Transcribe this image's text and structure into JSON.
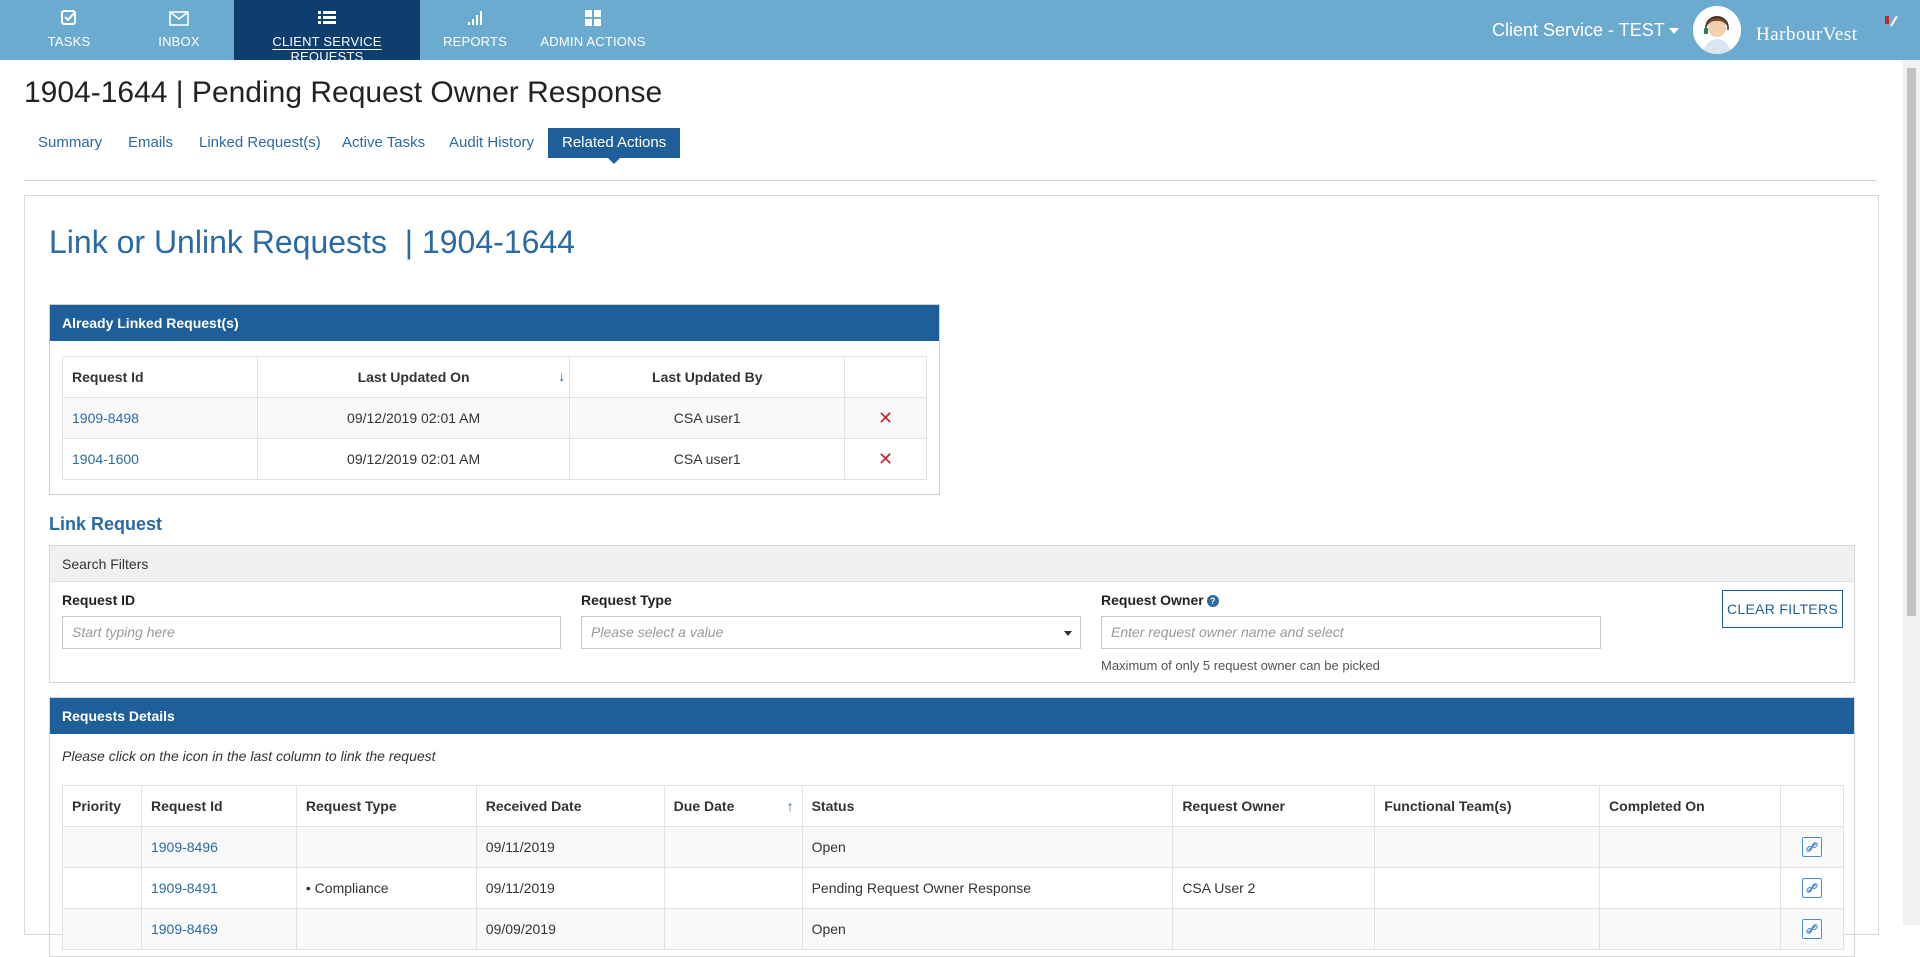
{
  "nav": {
    "items": [
      {
        "label": "TASKS",
        "icon": "checkbox-icon"
      },
      {
        "label": "INBOX",
        "icon": "envelope-icon"
      },
      {
        "label": "CLIENT SERVICE REQUESTS",
        "icon": "list-icon",
        "active": true
      },
      {
        "label": "REPORTS",
        "icon": "signal-bars-icon"
      },
      {
        "label": "ADMIN ACTIONS",
        "icon": "grid-icon"
      }
    ],
    "user_menu": "Client Service - TEST",
    "brand": "HarbourVest"
  },
  "page": {
    "title": "1904-1644 | Pending Request Owner Response",
    "tabs": [
      "Summary",
      "Emails",
      "Linked Request(s)",
      "Active Tasks",
      "Audit History",
      "Related Actions"
    ],
    "active_tab": "Related Actions"
  },
  "section": {
    "title": "Link or Unlink Requests  | 1904-1644"
  },
  "linked": {
    "header": "Already Linked Request(s)",
    "columns": [
      "Request Id",
      "Last Updated On",
      "Last Updated By",
      ""
    ],
    "rows": [
      {
        "id": "1909-8498",
        "updated_on": "09/12/2019 02:01 AM",
        "updated_by": "CSA user1"
      },
      {
        "id": "1904-1600",
        "updated_on": "09/12/2019 02:01 AM",
        "updated_by": "CSA user1"
      }
    ]
  },
  "link_request": {
    "title": "Link Request",
    "filters_header": "Search Filters",
    "request_id_label": "Request ID",
    "request_id_placeholder": "Start typing here",
    "request_type_label": "Request Type",
    "request_type_placeholder": "Please select a value",
    "owner_label": "Request Owner",
    "owner_placeholder": "Enter request owner name and select",
    "owner_hint": "Maximum of only 5 request owner can be picked",
    "clear_button": "CLEAR FILTERS"
  },
  "details": {
    "header": "Requests Details",
    "instruction": "Please click on the icon in the last column to link the request",
    "columns": [
      "Priority",
      "Request Id",
      "Request Type",
      "Received Date",
      "Due Date",
      "Status",
      "Request Owner",
      "Functional Team(s)",
      "Completed On",
      ""
    ],
    "rows": [
      {
        "priority": "",
        "id": "1909-8496",
        "type": "",
        "received": "09/11/2019",
        "due": "",
        "status": "Open",
        "owner": "",
        "team": "",
        "completed": ""
      },
      {
        "priority": "",
        "id": "1909-8491",
        "type": "• Compliance",
        "received": "09/11/2019",
        "due": "",
        "status": "Pending Request Owner Response",
        "owner": "CSA User 2",
        "team": "",
        "completed": ""
      },
      {
        "priority": "",
        "id": "1909-8469",
        "type": "",
        "received": "09/09/2019",
        "due": "",
        "status": "Open",
        "owner": "",
        "team": "",
        "completed": ""
      }
    ]
  },
  "colors": {
    "topbar": "#6cabd0",
    "active_nav": "#0d3e6e",
    "primary": "#1f5f99",
    "link": "#2b6aa3",
    "remove": "#c0272d"
  }
}
